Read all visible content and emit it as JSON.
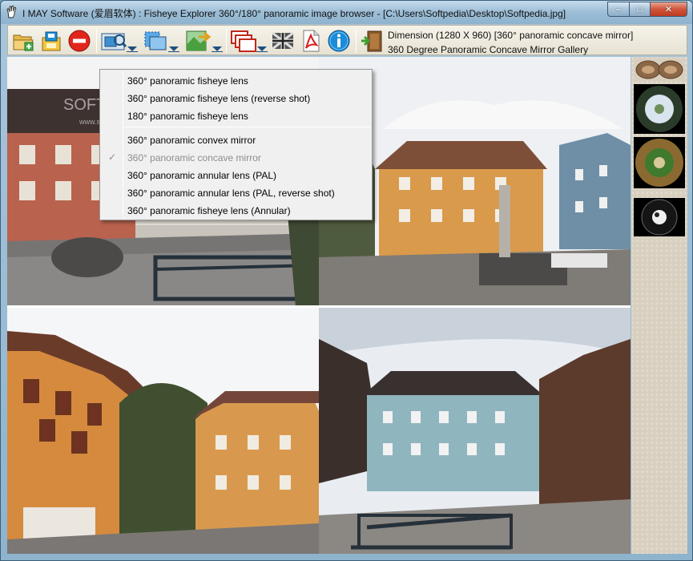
{
  "window": {
    "title": "I MAY Software (爱眉软体) : Fisheye Explorer 360°/180° panoramic image browser - [C:\\Users\\Softpedia\\Desktop\\Softpedia.jpg]",
    "minimize_label": "–",
    "maximize_label": "□",
    "close_label": "✕"
  },
  "toolbar": {
    "info_dimension": "Dimension (1280 X 960)    [360° panoramic concave mirror]",
    "info_gallery": "360 Degree Panoramic Concave Mirror Gallery"
  },
  "watermark": {
    "brand": "SOFTPEDIA",
    "url": "www.softpedia.com"
  },
  "menu": {
    "items": [
      {
        "label": "360° panoramic fisheye lens",
        "checked": false,
        "disabled": false
      },
      {
        "label": "360° panoramic fisheye lens (reverse shot)",
        "checked": false,
        "disabled": false
      },
      {
        "label": "180° panoramic fisheye lens",
        "checked": false,
        "disabled": false
      },
      {
        "label": "360° panoramic convex mirror",
        "checked": false,
        "disabled": false
      },
      {
        "label": "360° panoramic concave mirror",
        "checked": true,
        "disabled": true
      },
      {
        "label": "360° panoramic annular lens (PAL)",
        "checked": false,
        "disabled": false
      },
      {
        "label": "360° panoramic annular lens (PAL, reverse shot)",
        "checked": false,
        "disabled": false
      },
      {
        "label": "360° panoramic fisheye lens (Annular)",
        "checked": false,
        "disabled": false
      }
    ],
    "check_glyph": "✓"
  },
  "colors": {
    "accent": "#1c8bd8",
    "stop_red": "#e1261c",
    "menu_bg": "#f0f0f0"
  }
}
